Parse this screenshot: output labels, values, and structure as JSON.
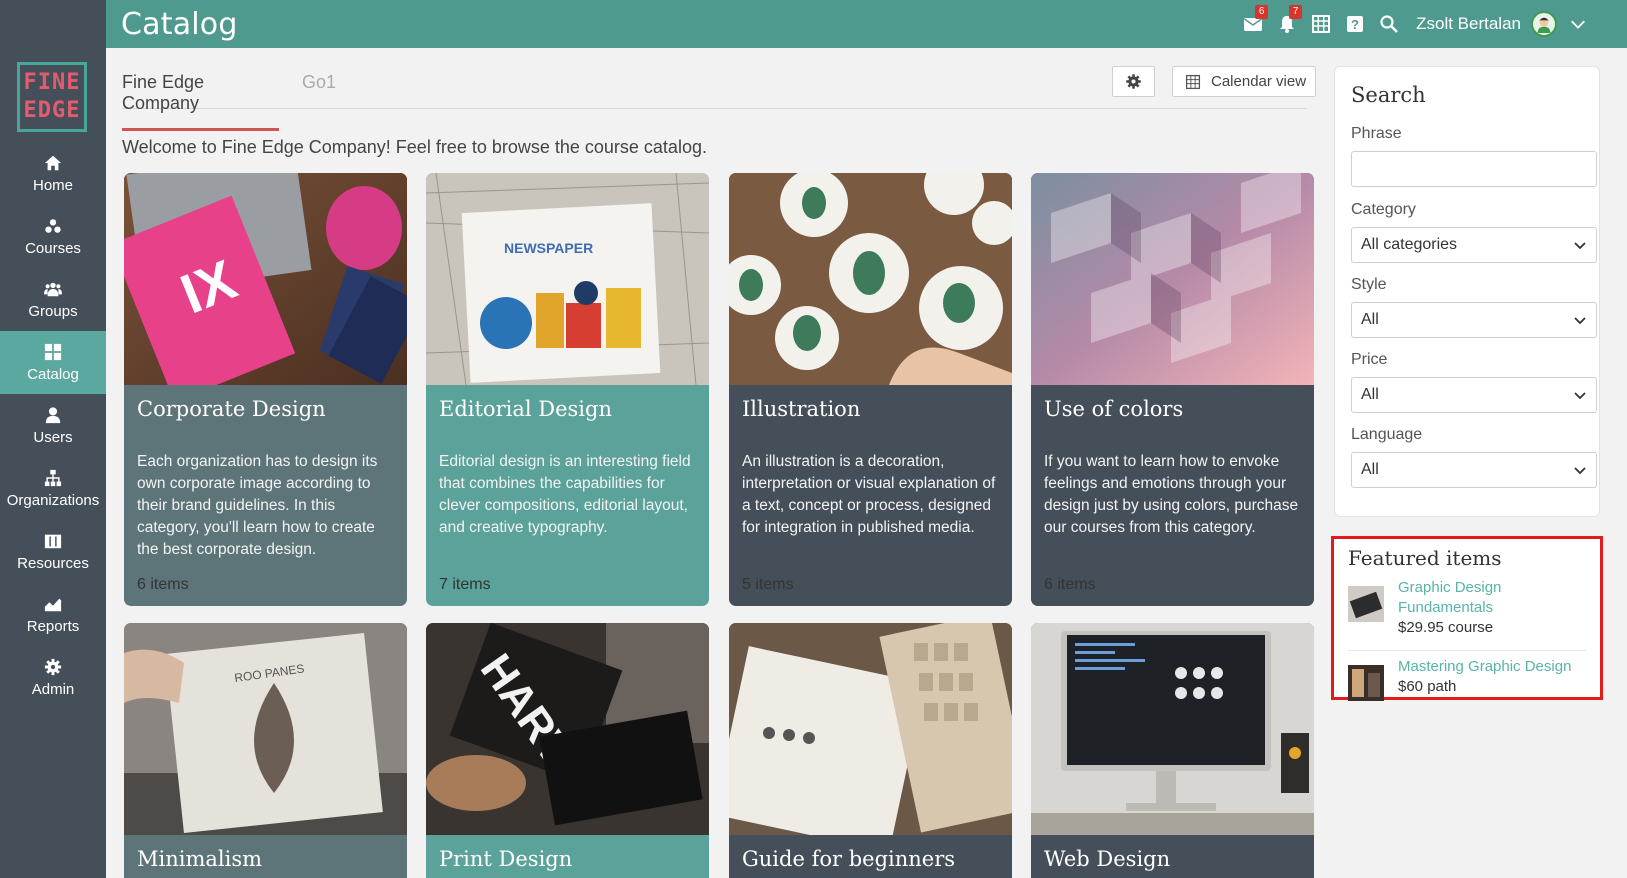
{
  "header": {
    "title": "Catalog",
    "messages_badge": "6",
    "notifications_badge": "7",
    "user_name": "Zsolt Bertalan"
  },
  "sidebar": {
    "logo_line1": "FINE",
    "logo_line2": "EDGE",
    "items": [
      {
        "label": "Home",
        "icon": "home-icon"
      },
      {
        "label": "Courses",
        "icon": "courses-icon"
      },
      {
        "label": "Groups",
        "icon": "groups-icon"
      },
      {
        "label": "Catalog",
        "icon": "catalog-icon",
        "active": true
      },
      {
        "label": "Users",
        "icon": "user-icon"
      },
      {
        "label": "Organizations",
        "icon": "org-icon"
      },
      {
        "label": "Resources",
        "icon": "resources-icon"
      },
      {
        "label": "Reports",
        "icon": "reports-icon"
      },
      {
        "label": "Admin",
        "icon": "gear-icon"
      }
    ]
  },
  "main": {
    "tabs": [
      {
        "label": "Fine Edge Company",
        "active": true
      },
      {
        "label": "Go1",
        "active": false
      }
    ],
    "calendar_button": "Calendar view",
    "welcome": "Welcome to Fine Edge Company! Feel free to browse the course catalog.",
    "cards": [
      {
        "title": "Corporate Design",
        "description": "Each organization has to design its own corporate image according to their brand guidelines. In this category, you'll learn how to create the best corporate design.",
        "count": "6 items"
      },
      {
        "title": "Editorial Design",
        "description": "Editorial design is an interesting field that combines the capabilities for clever compositions, editorial layout, and creative typography.",
        "count": "7 items"
      },
      {
        "title": "Illustration",
        "description": "An illustration is a decoration, interpretation or visual explanation of a text, concept or process, designed for integration in published media.",
        "count": "5 items"
      },
      {
        "title": "Use of colors",
        "description": "If you want to learn how to envoke feelings and emotions through your design just by using colors, purchase our courses from this category.",
        "count": "6 items"
      },
      {
        "title": "Minimalism"
      },
      {
        "title": "Print Design"
      },
      {
        "title": "Guide for beginners"
      },
      {
        "title": "Web Design"
      }
    ],
    "image_text": {
      "newspaper": "NEWSPAPER",
      "ix": "IX",
      "harvest": "HARVE",
      "vinyl": "ROO PANES"
    }
  },
  "search": {
    "title": "Search",
    "phrase_label": "Phrase",
    "phrase_value": "",
    "category_label": "Category",
    "category_value": "All categories",
    "style_label": "Style",
    "style_value": "All",
    "price_label": "Price",
    "price_value": "All",
    "language_label": "Language",
    "language_value": "All"
  },
  "featured": {
    "title": "Featured items",
    "items": [
      {
        "name": "Graphic Design Fundamentals",
        "price": "$29.95 course"
      },
      {
        "name": "Mastering Graphic Design",
        "price": "$60 path"
      }
    ]
  },
  "colors": {
    "header": "#4f9a8f",
    "sidebar": "#454f59",
    "active_nav": "#5aa8a0",
    "tab_underline": "#d0544f",
    "link": "#5ab3aa",
    "highlight": "#e21b1b"
  }
}
